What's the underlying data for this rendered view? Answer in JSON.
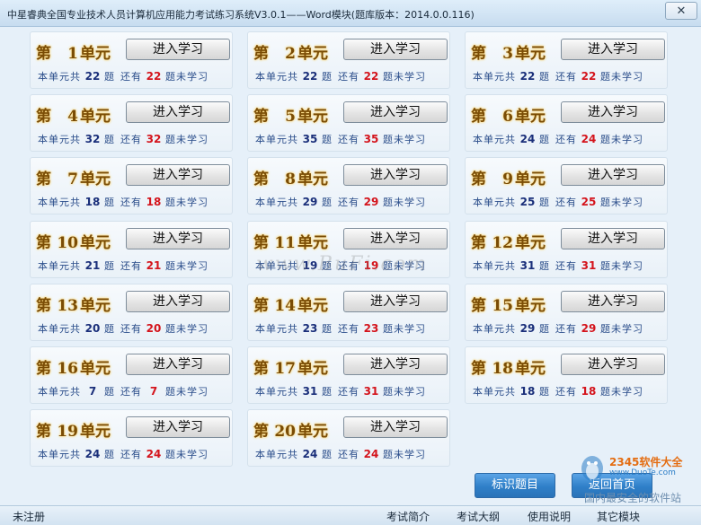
{
  "window": {
    "title": "中星睿典全国专业技术人员计算机应用能力考试练习系统V3.0.1——Word模块(题库版本：2014.0.0.116)",
    "close_label": "✕"
  },
  "labels": {
    "unit_prefix": "第",
    "unit_suffix": "单元",
    "enter_button": "进入学习",
    "total_prefix": "本单元共",
    "question_unit": "题",
    "remain_prefix": "还有",
    "remain_suffix": "题未学习"
  },
  "units": [
    {
      "num": "1",
      "total": "22",
      "remain": "22"
    },
    {
      "num": "2",
      "total": "22",
      "remain": "22"
    },
    {
      "num": "3",
      "total": "22",
      "remain": "22"
    },
    {
      "num": "4",
      "total": "32",
      "remain": "32"
    },
    {
      "num": "5",
      "total": "35",
      "remain": "35"
    },
    {
      "num": "6",
      "total": "24",
      "remain": "24"
    },
    {
      "num": "7",
      "total": "18",
      "remain": "18"
    },
    {
      "num": "8",
      "total": "29",
      "remain": "29"
    },
    {
      "num": "9",
      "total": "25",
      "remain": "25"
    },
    {
      "num": "10",
      "total": "21",
      "remain": "21"
    },
    {
      "num": "11",
      "total": "19",
      "remain": "19"
    },
    {
      "num": "12",
      "total": "31",
      "remain": "31"
    },
    {
      "num": "13",
      "total": "20",
      "remain": "20"
    },
    {
      "num": "14",
      "total": "23",
      "remain": "23"
    },
    {
      "num": "15",
      "total": "29",
      "remain": "29"
    },
    {
      "num": "16",
      "total": "7",
      "remain": "7"
    },
    {
      "num": "17",
      "total": "31",
      "remain": "31"
    },
    {
      "num": "18",
      "total": "18",
      "remain": "18"
    },
    {
      "num": "19",
      "total": "24",
      "remain": "24"
    },
    {
      "num": "20",
      "total": "24",
      "remain": "24"
    }
  ],
  "actions": {
    "mark_label": "标识题目",
    "home_label": "返回首页"
  },
  "statusbar": {
    "left": "未注册",
    "links": [
      "考试简介",
      "考试大纲",
      "使用说明",
      "其它模块"
    ]
  },
  "watermarks": {
    "center": "www.BuFi.com",
    "brand": "2345软件大全",
    "domain": "www.DuoTe.com",
    "slogan": "国内最安全的软件站"
  },
  "colors": {
    "total_number": "#1a2f7a",
    "remain_number": "#d4141c",
    "unit_title": "#7a4c05",
    "action_button": "#2f7fc8"
  }
}
